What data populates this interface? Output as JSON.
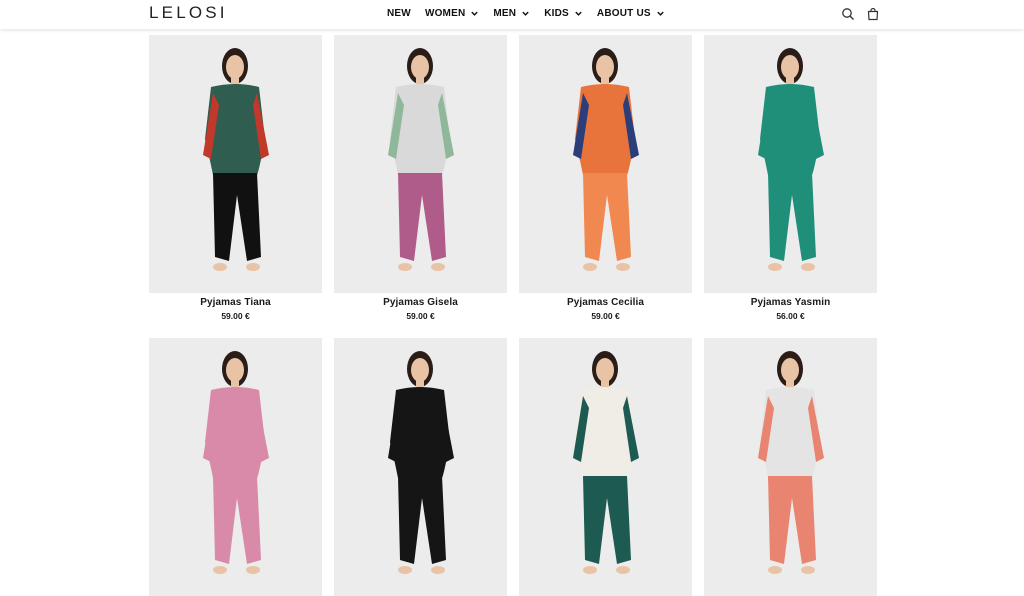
{
  "brand": {
    "logo": "LELOSI"
  },
  "nav": {
    "items": [
      {
        "label": "NEW",
        "dropdown": false
      },
      {
        "label": "WOMEN",
        "dropdown": true
      },
      {
        "label": "MEN",
        "dropdown": true
      },
      {
        "label": "KIDS",
        "dropdown": true
      },
      {
        "label": "ABOUT US",
        "dropdown": true
      }
    ]
  },
  "header_icons": [
    "search-icon",
    "shopping-bag-icon"
  ],
  "products": [
    {
      "name": "Pyjamas Tiana",
      "price": "59.00 €",
      "top": "#2f5d4f",
      "accent": "#c0392b",
      "pants": "#111111"
    },
    {
      "name": "Pyjamas Gisela",
      "price": "59.00 €",
      "top": "#d9d9d9",
      "accent": "#8fb89a",
      "pants": "#b05c8a"
    },
    {
      "name": "Pyjamas Cecilia",
      "price": "59.00 €",
      "top": "#e8743b",
      "accent": "#2c3e7a",
      "pants": "#f0884f"
    },
    {
      "name": "Pyjamas Yasmin",
      "price": "56.00 €",
      "top": "#1f8f7a",
      "accent": "#1f8f7a",
      "pants": "#1f8f7a"
    },
    {
      "name": "",
      "price": "",
      "top": "#d98aa8",
      "accent": "#d98aa8",
      "pants": "#d98aa8"
    },
    {
      "name": "",
      "price": "",
      "top": "#151515",
      "accent": "#151515",
      "pants": "#151515"
    },
    {
      "name": "",
      "price": "",
      "top": "#f0ece6",
      "accent": "#1d5a52",
      "pants": "#1d5a52"
    },
    {
      "name": "",
      "price": "",
      "top": "#e4e4e4",
      "accent": "#e8846f",
      "pants": "#e8846f"
    }
  ]
}
